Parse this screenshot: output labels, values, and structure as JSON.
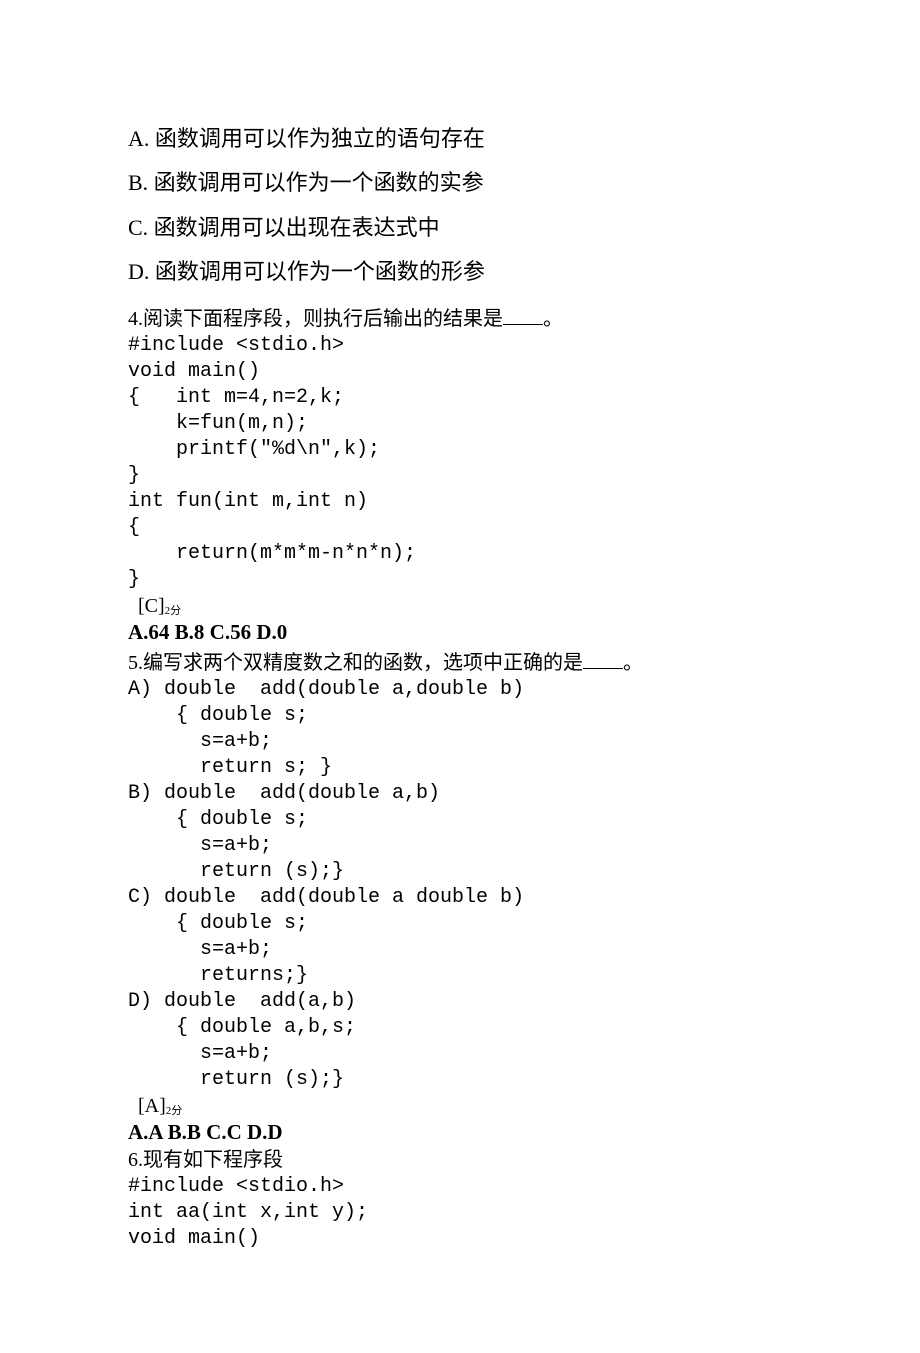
{
  "q3": {
    "opt_a": "A.  函数调用可以作为独立的语句存在",
    "opt_b": "B.  函数调用可以作为一个函数的实参",
    "opt_c": "C.  函数调用可以出现在表达式中",
    "opt_d": "D.  函数调用可以作为一个函数的形参"
  },
  "q4": {
    "stem_pre": "4.阅读下面程序段，则执行后输出的结果是",
    "stem_post": "。",
    "code": [
      "#include <stdio.h>",
      "void main()",
      "{   int m=4,n=2,k;",
      "    k=fun(m,n);",
      "    printf(\"%d\\n\",k);",
      "}",
      "int fun(int m,int n)",
      "{",
      "    return(m*m*m-n*n*n);",
      "}"
    ],
    "answer_label": "[C]",
    "answer_pts": "2分",
    "choices": "A.64   B.8   C.56   D.0"
  },
  "q5": {
    "stem_pre": "5.编写求两个双精度数之和的函数，选项中正确的是",
    "stem_post": "。",
    "opts": [
      "A) double  add(double a,double b)",
      "    { double s;",
      "      s=a+b;",
      "      return s; }",
      "B) double  add(double a,b)",
      "    { double s;",
      "      s=a+b;",
      "      return (s);}",
      "C) double  add(double a double b)",
      "    { double s;",
      "      s=a+b;",
      "      returns;}",
      "D) double  add(a,b)",
      "    { double a,b,s;",
      "      s=a+b;",
      "      return (s);}"
    ],
    "answer_label": "[A]",
    "answer_pts": "2分",
    "choices": "A.A   B.B   C.C   D.D"
  },
  "q6": {
    "stem": "6.现有如下程序段",
    "code": [
      "#include <stdio.h>",
      "int aa(int x,int y);",
      "void main()"
    ]
  }
}
